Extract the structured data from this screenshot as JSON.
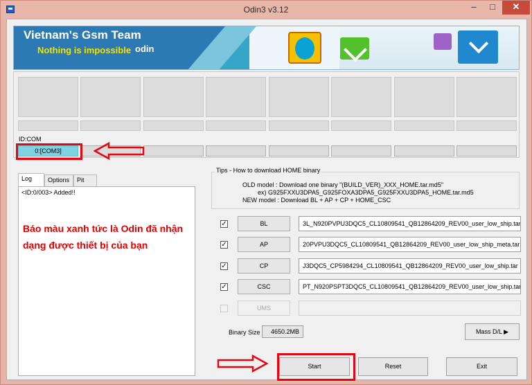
{
  "window": {
    "title": "Odin3 v3.12",
    "min_glyph": "–",
    "max_glyph": "□",
    "close_glyph": "✕"
  },
  "banner": {
    "team": "Vietnam's Gsm Team",
    "slogan": "Nothing is impossible",
    "odin": "odin"
  },
  "id_com": {
    "label": "ID:COM",
    "port": "0:[COM3]"
  },
  "tabs": [
    "Log",
    "Options",
    "Pit"
  ],
  "log": {
    "entries": [
      "<ID:0/003> Added!!"
    ],
    "annotation": "Báo màu xanh tức là Odin đã nhận dạng được thiết bị của bạn"
  },
  "tips": {
    "title": "Tips - How to download HOME binary",
    "line1": "OLD model  : Download one binary    \"(BUILD_VER)_XXX_HOME.tar.md5\"",
    "line2": "ex) G925FXXU3DPA5_G925FOXA3DPA5_G925FXXU3DPA5_HOME.tar.md5",
    "line3": "NEW model : Download BL + AP + CP + HOME_CSC"
  },
  "files": [
    {
      "label": "BL",
      "checked": true,
      "path": "3L_N920PVPU3DQC5_CL10809541_QB12864209_REV00_user_low_ship.tar"
    },
    {
      "label": "AP",
      "checked": true,
      "path": "20PVPU3DQC5_CL10809541_QB12864209_REV00_user_low_ship_meta.tar"
    },
    {
      "label": "CP",
      "checked": true,
      "path": "J3DQC5_CP5984294_CL10809541_QB12864209_REV00_user_low_ship.tar"
    },
    {
      "label": "CSC",
      "checked": true,
      "path": "PT_N920PSPT3DQC5_CL10809541_QB12864209_REV00_user_low_ship.tar"
    },
    {
      "label": "UMS",
      "checked": false,
      "path": ""
    }
  ],
  "binary_size": {
    "label": "Binary Size",
    "value": "4650.2MB"
  },
  "buttons": {
    "mass_dl": "Mass D/L ▶",
    "start": "Start",
    "reset": "Reset",
    "exit": "Exit"
  },
  "check_glyph": "✓",
  "colors": {
    "active_port": "#7fd2e2",
    "annotation": "#e00000",
    "highlight": "#e30613"
  }
}
